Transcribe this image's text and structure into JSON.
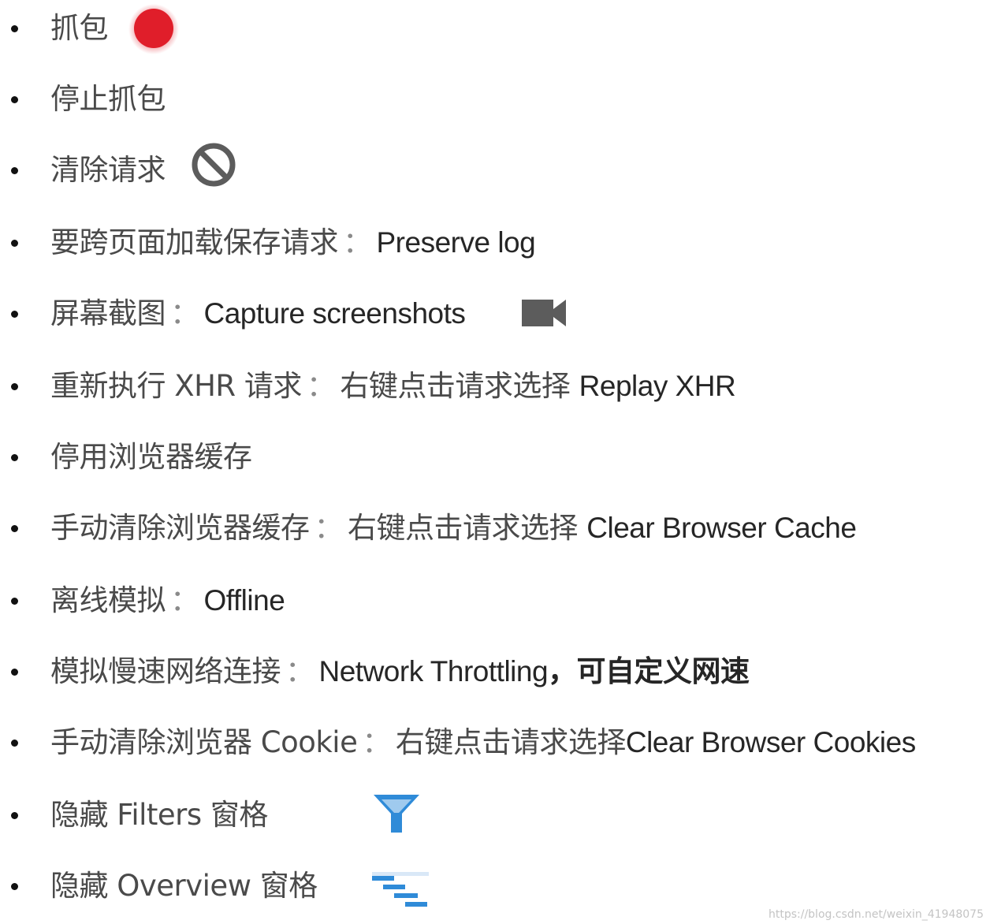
{
  "items": [
    {
      "zh": "抓包",
      "icon": "record-icon",
      "icon_color": "#e01e2a"
    },
    {
      "zh": "停止抓包"
    },
    {
      "zh": "清除请求",
      "icon": "clear-icon",
      "icon_color": "#5c5c5c"
    },
    {
      "zh": "要跨页面加载保存请求",
      "sep": "：",
      "en": "Preserve log"
    },
    {
      "zh": "屏幕截图",
      "sep": "：",
      "en": "Capture screenshots",
      "icon": "video-camera-icon",
      "icon_color": "#5c5c5c"
    },
    {
      "zh": "重新执行 XHR 请求",
      "sep": "：",
      "zh2": "右键点击请求选择",
      "en": "Replay XHR"
    },
    {
      "zh": "停用浏览器缓存"
    },
    {
      "zh": "手动清除浏览器缓存",
      "sep": "：",
      "zh2": "右键点击请求选择",
      "en": "Clear Browser Cache"
    },
    {
      "zh": "离线模拟",
      "sep": "：",
      "en": "Offline"
    },
    {
      "zh": "模拟慢速网络连接",
      "sep": "：",
      "en": "Network Throttling",
      "bold": "，可自定义网速"
    },
    {
      "zh": "手动清除浏览器 Cookie",
      "sep": "：",
      "zh2": "右键点击请求选择",
      "en": "Clear Browser Cookies"
    },
    {
      "zh": "隐藏 Filters 窗格",
      "icon": "filter-icon",
      "icon_color": "#2f8bd8"
    },
    {
      "zh": "隐藏 Overview 窗格",
      "icon": "overview-icon",
      "icon_color": "#2f8bd8"
    }
  ],
  "watermark": "https://blog.csdn.net/weixin_41948075"
}
